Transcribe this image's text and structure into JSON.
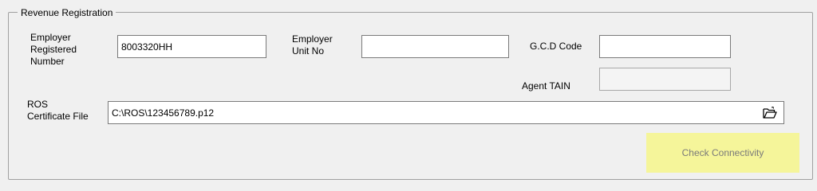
{
  "group": {
    "title": "Revenue Registration"
  },
  "fields": {
    "employer_registered_number": {
      "label": "Employer\nRegistered\nNumber",
      "value": "8003320HH"
    },
    "employer_unit_no": {
      "label": "Employer\nUnit No",
      "value": ""
    },
    "gcd_code": {
      "label": "G.C.D Code",
      "value": ""
    },
    "agent_tain": {
      "label": "Agent TAIN",
      "value": ""
    },
    "ros_certificate_file": {
      "label": "ROS\nCertificate File",
      "value": "C:\\ROS\\123456789.p12"
    }
  },
  "buttons": {
    "browse_icon": "folder-open-icon",
    "check_connectivity": "Check Connectivity"
  },
  "colors": {
    "background": "#f0f0f0",
    "check_button_bg": "#f5f59a",
    "check_button_text": "#7a7a7a"
  }
}
